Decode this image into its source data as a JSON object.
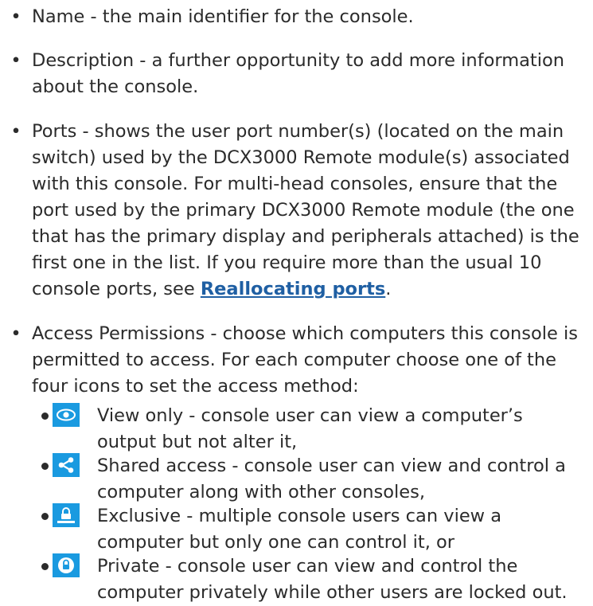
{
  "items": [
    {
      "bullet": "•",
      "text": "Name - the main identifier for the console."
    },
    {
      "bullet": "•",
      "text": "Description - a further opportunity to add more information about the console."
    },
    {
      "bullet": "•",
      "text_before": "Ports - shows the user port number(s) (located on the main switch) used by the DCX3000 Remote module(s) associated with this console. For multi-head consoles, ensure that the port used by the primary DCX3000 Remote module (the one that has the primary display and peripherals attached) is the first one in the list. If you require more than the usual 10 console ports, see ",
      "link": "Reallocating ports",
      "text_after": "."
    },
    {
      "bullet": "•",
      "text": "Access Permissions - choose which computers this console is permitted to access. For each computer choose one of the four icons to set the access method:"
    }
  ],
  "access_methods": [
    {
      "icon": "eye-icon",
      "text": "View only - console user can view a computer’s output but not alter it,"
    },
    {
      "icon": "share-icon",
      "text": "Shared access - console user can view and control a computer along with other consoles,"
    },
    {
      "icon": "exclusive-lock-icon",
      "text": "Exclusive - multiple console users can view a computer but only one can control it, or"
    },
    {
      "icon": "private-lock-icon",
      "text": "Private - console user can view and control the computer privately while other users are locked out."
    }
  ],
  "colors": {
    "icon_background": "#1a9ae0",
    "link": "#1f5fa3",
    "text": "#2b2b2b"
  }
}
